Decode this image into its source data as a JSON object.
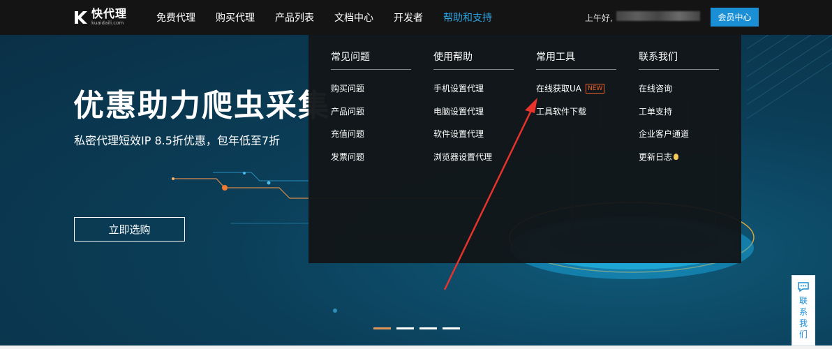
{
  "logo": {
    "cn": "快代理",
    "en": "kuaidaili.com"
  },
  "nav": {
    "items": [
      {
        "label": "免费代理",
        "active": false
      },
      {
        "label": "购买代理",
        "active": false
      },
      {
        "label": "产品列表",
        "active": false
      },
      {
        "label": "文档中心",
        "active": false
      },
      {
        "label": "开发者",
        "active": false
      },
      {
        "label": "帮助和支持",
        "active": true
      }
    ],
    "greeting": "上午好,",
    "member_button": "会员中心"
  },
  "hero": {
    "title": "优惠助力爬虫采集",
    "subtitle": "私密代理短效IP 8.5折优惠，包年低至7折",
    "cta": "立即选购",
    "slides": 4,
    "active_slide": 0
  },
  "dropdown": {
    "columns": [
      {
        "title": "常见问题",
        "items": [
          "购买问题",
          "产品问题",
          "充值问题",
          "发票问题"
        ]
      },
      {
        "title": "使用帮助",
        "items": [
          "手机设置代理",
          "电脑设置代理",
          "软件设置代理",
          "浏览器设置代理"
        ]
      },
      {
        "title": "常用工具",
        "items": [
          "在线获取UA",
          "工具软件下载"
        ],
        "badge": "NEW"
      },
      {
        "title": "联系我们",
        "items": [
          "在线咨询",
          "工单支持",
          "企业客户通道",
          "更新日志"
        ]
      }
    ]
  },
  "float_contact": {
    "label": "联系我们",
    "chars": [
      "联",
      "系",
      "我",
      "们"
    ]
  },
  "colors": {
    "accent": "#1b8fd6",
    "active_nav": "#2ba4e0",
    "badge": "#e8612c",
    "arrow": "#e8322c"
  }
}
